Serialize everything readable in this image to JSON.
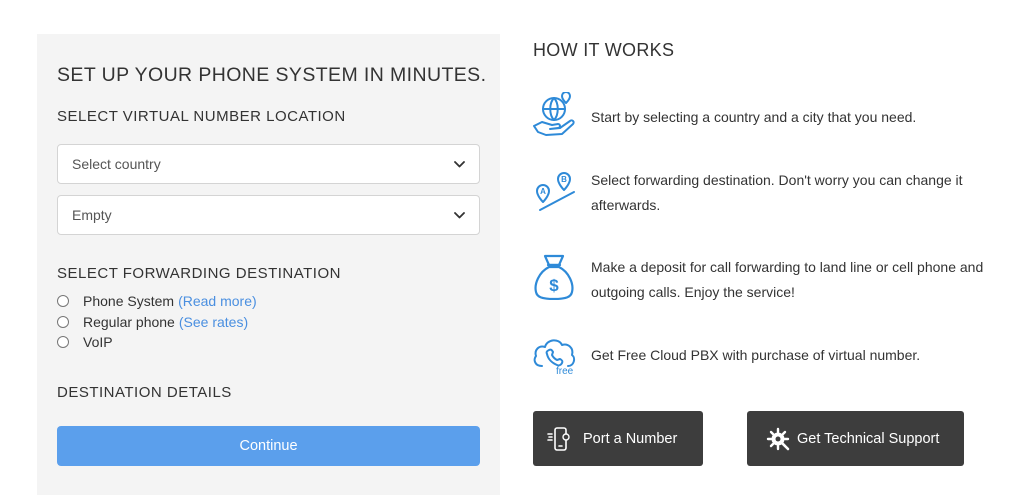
{
  "form": {
    "title": "SET UP YOUR PHONE SYSTEM IN MINUTES.",
    "location_heading": "SELECT VIRTUAL NUMBER LOCATION",
    "country_select": {
      "value": "Select country"
    },
    "city_select": {
      "value": "Empty"
    },
    "forwarding_heading": "SELECT FORWARDING DESTINATION",
    "options": [
      {
        "label": "Phone System",
        "link": "(Read more)"
      },
      {
        "label": "Regular phone",
        "link": "(See rates)"
      },
      {
        "label": "VoIP",
        "link": ""
      }
    ],
    "details_heading": "DESTINATION DETAILS",
    "continue_label": "Continue"
  },
  "how": {
    "title": "HOW IT WORKS",
    "steps": [
      {
        "icon": "globe-hand-icon",
        "text": "Start by selecting a country and a city that you need."
      },
      {
        "icon": "route-ab-icon",
        "text": "Select forwarding destination. Don't worry you can change it afterwards."
      },
      {
        "icon": "money-bag-icon",
        "text": "Make a deposit for call forwarding to land line or cell phone and outgoing calls. Enjoy the service!"
      },
      {
        "icon": "cloud-phone-icon",
        "text": "Get Free Cloud PBX with purchase of virtual number.",
        "badge": "free"
      }
    ]
  },
  "actions": {
    "port_label": "Port a Number",
    "support_label": "Get Technical Support"
  },
  "colors": {
    "accent": "#5b9fec",
    "icon_blue": "#2e8ad8",
    "link": "#4a8fe0",
    "dark_button": "#3d3d3d",
    "panel_bg": "#f4f4f4"
  }
}
